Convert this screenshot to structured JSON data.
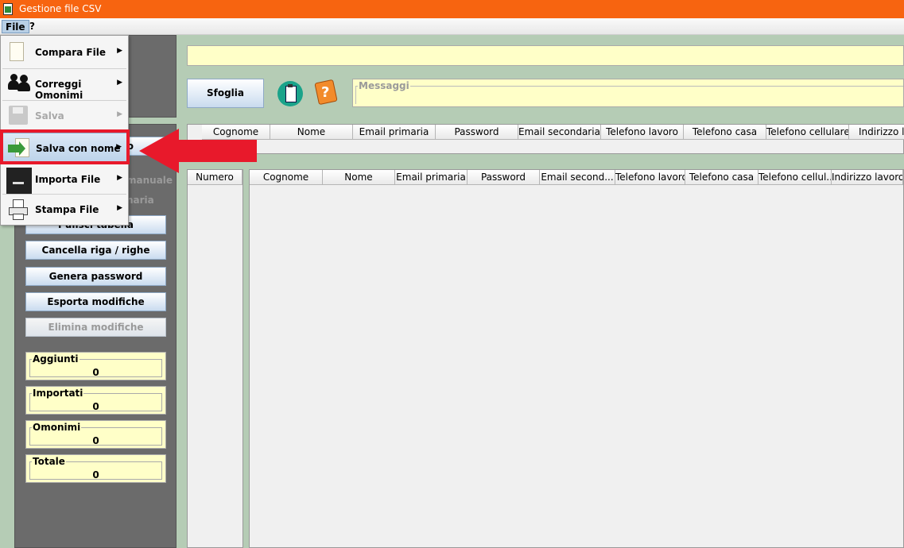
{
  "window": {
    "title": "Gestione file CSV"
  },
  "menubar": {
    "file": "File",
    "help": "?"
  },
  "file_menu": {
    "items": [
      {
        "label": "Compara File",
        "icon": "document-icon",
        "enabled": true,
        "submenu": true
      },
      {
        "label": "Correggi Omonimi",
        "icon": "people-icon",
        "enabled": true,
        "submenu": true
      },
      {
        "label": "Salva",
        "icon": "floppy-disk-icon",
        "enabled": false,
        "submenu": true
      },
      {
        "label": "Salva con nome",
        "icon": "save-as-icon",
        "enabled": true,
        "submenu": true,
        "highlighted": true
      },
      {
        "label": "Importa File",
        "icon": "import-icon",
        "enabled": true,
        "submenu": true
      },
      {
        "label": "Stampa File",
        "icon": "printer-icon",
        "enabled": true,
        "submenu": true
      }
    ]
  },
  "sidebar": {
    "hidden_button_fragment": "o",
    "label_manual": "manuale",
    "label_primary": "naria",
    "buttons": [
      {
        "label": "Pulisci tabella",
        "enabled": true
      },
      {
        "label": "Cancella riga / righe",
        "enabled": true
      },
      {
        "label": "Genera password",
        "enabled": true
      },
      {
        "label": "Esporta modifiche",
        "enabled": true
      },
      {
        "label": "Elimina modifiche",
        "enabled": false
      }
    ],
    "counters": [
      {
        "label": "Aggiunti",
        "value": "0"
      },
      {
        "label": "Importati",
        "value": "0"
      },
      {
        "label": "Omonimi",
        "value": "0"
      },
      {
        "label": "Totale",
        "value": "0"
      }
    ]
  },
  "toolbar": {
    "path_value": "",
    "browse_label": "Sfoglia",
    "messages_label": "Messaggi"
  },
  "table_top": {
    "columns": [
      "Cognome",
      "Nome",
      "Email primaria",
      "Password",
      "Email secondaria",
      "Telefono lavoro",
      "Telefono casa",
      "Telefono cellulare",
      "Indirizzo la"
    ]
  },
  "number_column": {
    "header": "Numero"
  },
  "table_bottom": {
    "columns": [
      "Cognome",
      "Nome",
      "Email primaria",
      "Password",
      "Email second...",
      "Telefono lavoro",
      "Telefono casa",
      "Telefono cellul...",
      "Indirizzo lavoro"
    ]
  },
  "colors": {
    "titlebar": "#f76410",
    "panel_green": "#b5ccb5",
    "panel_dark": "#6b6b6b",
    "field_yellow": "#ffffc8",
    "highlight_red": "#e8192b"
  }
}
